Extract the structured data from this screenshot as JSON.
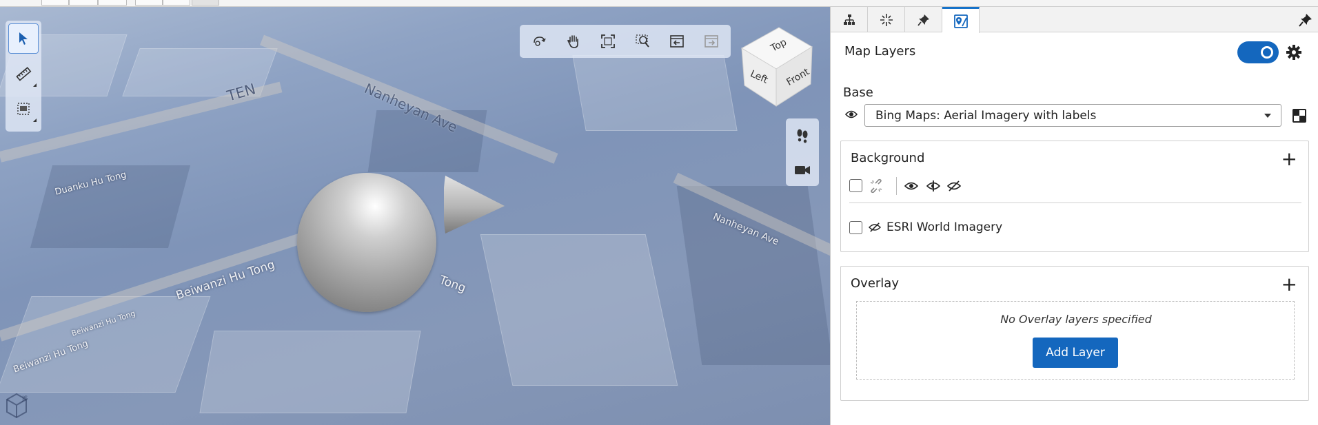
{
  "viewport": {
    "street_labels": [
      "Nanheyan Ave",
      "Duanku Hu Tong",
      "Beiwanzi Hu Tong",
      "Beiwanzi Hu Tong",
      "Tong",
      "Nanheyan Ave",
      "Beiwanzi Hu Tong"
    ],
    "big_labels": [
      "TEN"
    ],
    "cube": {
      "top": "Top",
      "left": "Left",
      "front": "Front"
    },
    "left_tools": [
      "select-pointer-icon",
      "measure-ruler-icon",
      "clip-box-icon"
    ],
    "nav_tools": [
      "orbit-icon",
      "pan-hand-icon",
      "zoom-extents-icon",
      "zoom-window-icon",
      "view-back-icon",
      "view-forward-icon"
    ],
    "side_tools": [
      "walk-footprints-icon",
      "camera-icon"
    ],
    "logo_text": "JS"
  },
  "panel": {
    "tabs": [
      "model-tree-icon",
      "snap-icon",
      "pin-icon",
      "map-layers-icon"
    ],
    "active_tab": 3,
    "title": "Map Layers",
    "toggle_on": true,
    "base": {
      "label": "Base",
      "selected": "Bing Maps: Aerial Imagery with labels"
    },
    "background": {
      "title": "Background",
      "layers": [
        {
          "name": "ESRI World Imagery",
          "checked": false
        }
      ]
    },
    "overlay": {
      "title": "Overlay",
      "empty_message": "No Overlay layers specified",
      "add_label": "Add Layer"
    },
    "colors": {
      "accent": "#1467be"
    }
  }
}
